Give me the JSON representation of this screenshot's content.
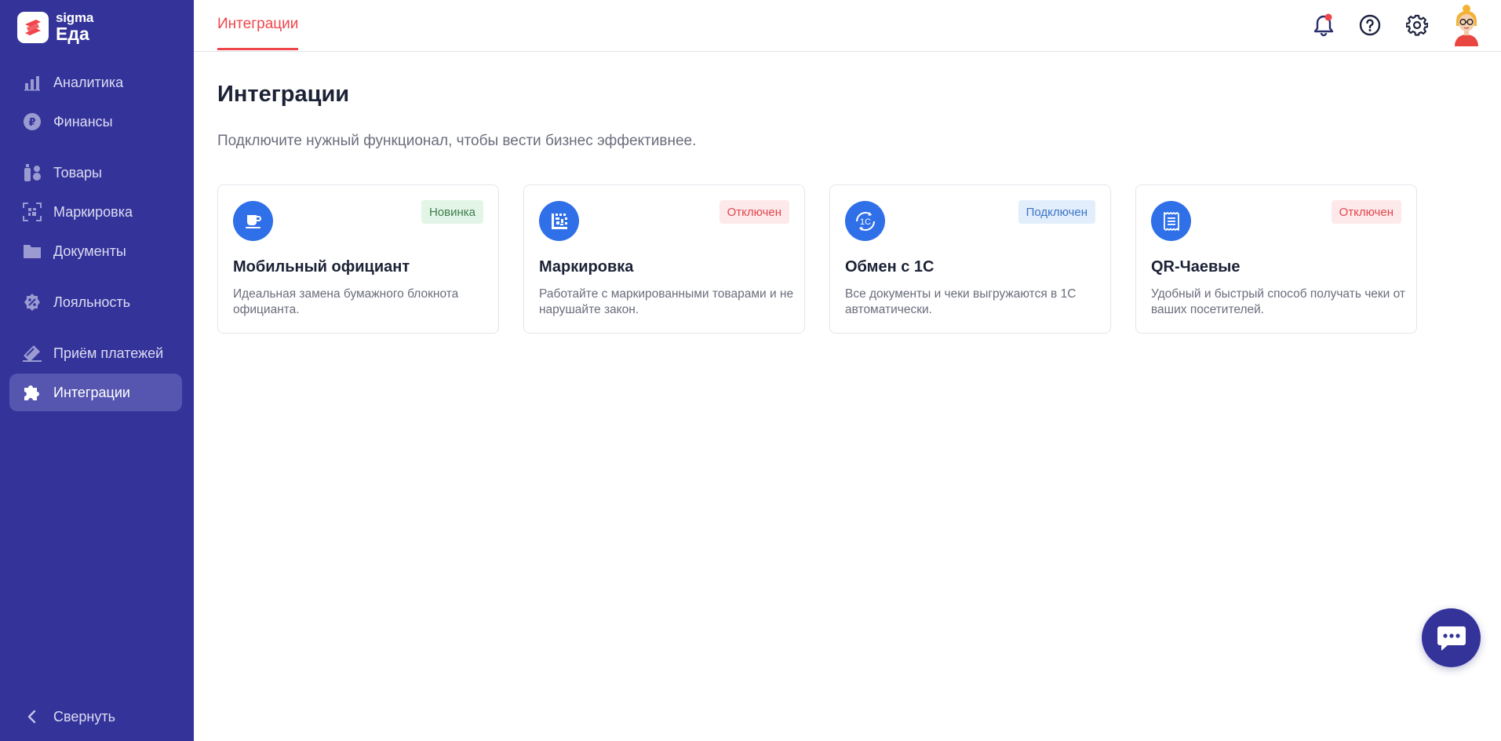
{
  "app": {
    "brand_small": "sigma",
    "brand_large": "Еда"
  },
  "sidebar": {
    "items": [
      {
        "label": "Аналитика",
        "icon": "bar-chart-icon"
      },
      {
        "label": "Финансы",
        "icon": "ruble-coin-icon"
      },
      {
        "label": "Товары",
        "icon": "bottles-icon"
      },
      {
        "label": "Маркировка",
        "icon": "datamatrix-icon"
      },
      {
        "label": "Документы",
        "icon": "folder-icon"
      },
      {
        "label": "Лояльность",
        "icon": "discount-badge-icon"
      },
      {
        "label": "Приём платежей",
        "icon": "card-payment-icon"
      },
      {
        "label": "Интеграции",
        "icon": "puzzle-icon",
        "active": true
      }
    ],
    "collapse_label": "Свернуть"
  },
  "header": {
    "active_tab": "Интеграции",
    "icons": [
      "bell-icon",
      "help-icon",
      "gear-icon",
      "avatar"
    ],
    "has_notification": true
  },
  "main": {
    "title": "Интеграции",
    "subtitle": "Подключите нужный функционал, чтобы вести бизнес эффективнее.",
    "cards": [
      {
        "title": "Мобильный официант",
        "description": "Идеальная замена бумажного блокнота официанта.",
        "badge": "Новинка",
        "badge_type": "new",
        "icon": "coffee-cup-icon"
      },
      {
        "title": "Маркировка",
        "description": "Работайте с маркированными товарами и не нарушайте закон.",
        "badge": "Отключен",
        "badge_type": "off",
        "icon": "datamatrix-icon"
      },
      {
        "title": "Обмен с 1С",
        "description": "Все документы и чеки выгружаются в 1С автоматически.",
        "badge": "Подключен",
        "badge_type": "on",
        "icon": "sync-1c-icon",
        "icon_text": "1C"
      },
      {
        "title": "QR-Чаевые",
        "description": "Удобный и быстрый способ получать чеки от ваших посетителей.",
        "badge": "Отключен",
        "badge_type": "off",
        "icon": "receipt-icon"
      }
    ]
  },
  "colors": {
    "sidebar_bg": "#33339a",
    "accent_red": "#f0454b",
    "card_icon_blue": "#2f6fe8",
    "title_text": "#1c2236"
  }
}
